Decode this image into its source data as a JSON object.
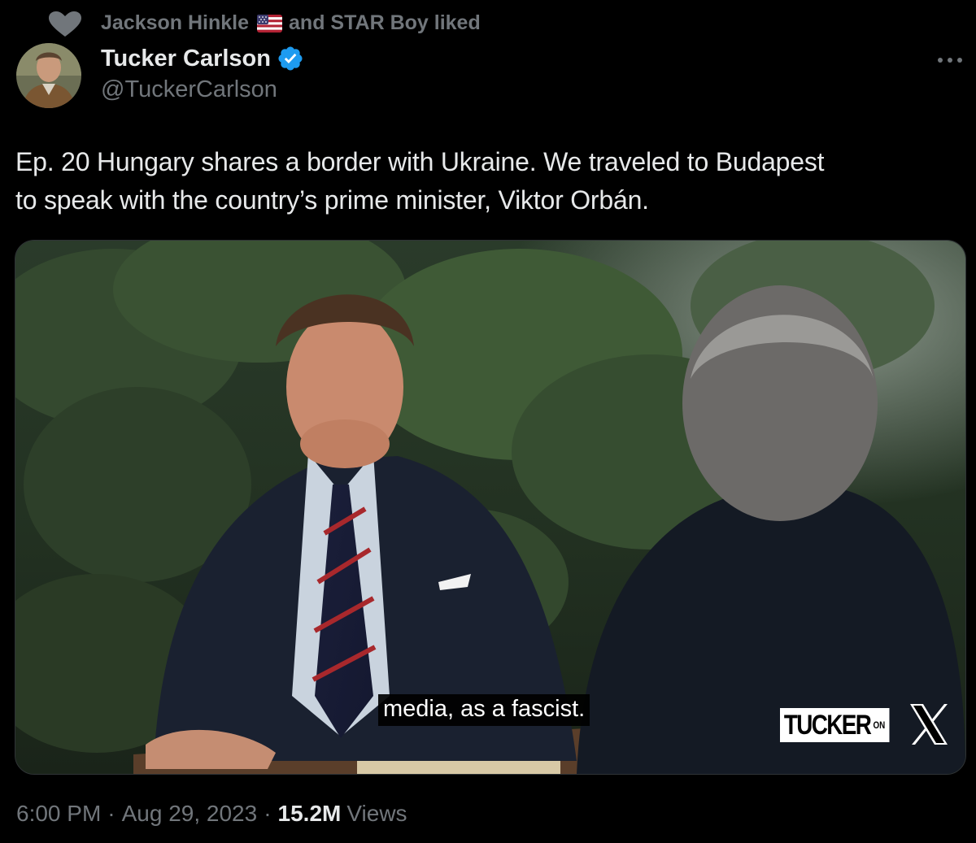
{
  "social_context": {
    "user_one": "Jackson Hinkle",
    "user_one_flag": "us-flag-icon",
    "rest": "and STAR Boy liked"
  },
  "author": {
    "display_name": "Tucker Carlson",
    "handle": "@TuckerCarlson",
    "verified": true
  },
  "tweet": {
    "text_line_1": "Ep. 20  Hungary shares a border with Ukraine. We traveled to Budapest",
    "text_line_2": "to speak with the country’s prime minister, Viktor Orbán."
  },
  "media": {
    "subtitle": "media, as a fascist.",
    "brand_name": "TUCKER",
    "brand_on": "ON",
    "brand_x": "X"
  },
  "meta": {
    "time": "6:00 PM",
    "date": "Aug 29, 2023",
    "views_count": "15.2M",
    "views_label": "Views",
    "separator": "·"
  },
  "colors": {
    "background": "#000000",
    "primary_text": "#e7e9ea",
    "secondary_text": "#71767b",
    "verified_blue": "#1d9bf0"
  }
}
